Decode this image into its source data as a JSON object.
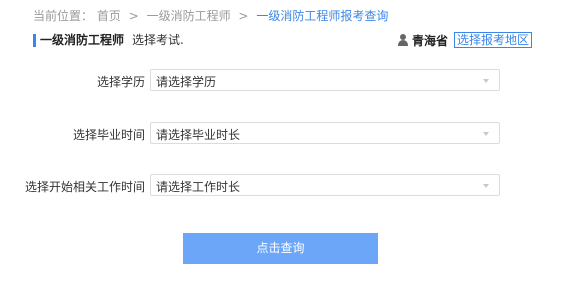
{
  "breadcrumb": {
    "prefix": "当前位置：",
    "items": [
      "首页",
      "一级消防工程师",
      "一级消防工程师报考查询"
    ],
    "separator": ">"
  },
  "header": {
    "title": "一级消防工程师",
    "subtitle": "选择考试.",
    "region_icon": "user-icon",
    "region_name": "青海省",
    "region_button": "选择报考地区"
  },
  "form": {
    "fields": [
      {
        "label": "选择学历",
        "value": "请选择学历"
      },
      {
        "label": "选择毕业时间",
        "value": "请选择毕业时长"
      },
      {
        "label": "选择开始相关工作时间",
        "value": "请选择工作时长"
      }
    ],
    "submit_label": "点击查询"
  },
  "colors": {
    "accent": "#3b86e8",
    "button": "#6ba6f8",
    "border": "#dcdcdc"
  }
}
